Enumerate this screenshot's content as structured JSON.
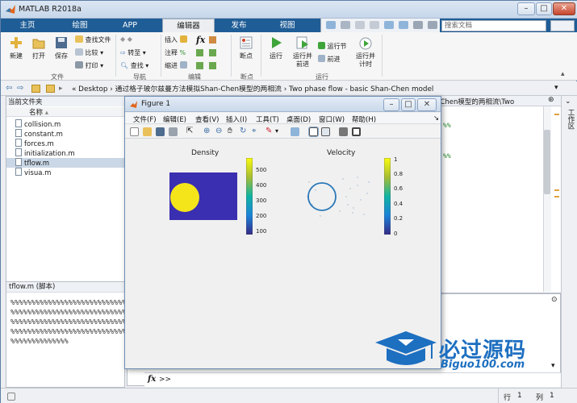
{
  "app": {
    "title": "MATLAB R2018a"
  },
  "tabs": [
    "主页",
    "绘图",
    "APP",
    "编辑器",
    "发布",
    "视图"
  ],
  "active_tab": "编辑器",
  "search": {
    "placeholder": "搜索文档"
  },
  "ribbon": {
    "file": {
      "new": "新建",
      "open": "打开",
      "save": "保存",
      "find_files": "查找文件",
      "compare": "比较",
      "print": "打印",
      "group": "文件"
    },
    "navigate": {
      "goto": "转至",
      "find": "查找",
      "group": "导航"
    },
    "edit": {
      "insert": "插入",
      "comment": "注释",
      "indent": "缩进",
      "fx": "fx",
      "group": "编辑"
    },
    "breakpoints": {
      "label": "断点",
      "group": "断点"
    },
    "run": {
      "run": "运行",
      "run_advance": "运行并\n前进",
      "run_section": "运行节",
      "advance": "前进",
      "run_time": "运行并\n计时",
      "group": "运行"
    }
  },
  "address": {
    "path": "« Desktop › 通过格子玻尔兹曼方法模拟Shan-Chen模型的两相流 › Two phase flow - basic Shan-Chen model",
    "editor_tab": "n-Chen模型的两相流\\Two"
  },
  "current_folder": {
    "header": "当前文件夹",
    "column": "名称",
    "files": [
      "collision.m",
      "constant.m",
      "forces.m",
      "initialization.m",
      "tflow.m",
      "visua.m"
    ],
    "selected": "tflow.m"
  },
  "details": {
    "header": "tflow.m  (脚本)",
    "lines": [
      "%%%%%%%%%%%%%%%%%%%%%%%%%%%%",
      "%%%%%%%%%%%%%%%%%%%%%%%%%%%%",
      "%%%%%%%%%%%%%%%%%%%%%%%%%%%%",
      "%%%%%%%%%%%%%%%%%%%%%%%%%%%%",
      "%%%%%%%%%%%%%%"
    ]
  },
  "editor_snippets": [
    "%%",
    "%%"
  ],
  "workspace_side": "工作区",
  "figure": {
    "title": "Figure 1",
    "menu": [
      "文件(F)",
      "编辑(E)",
      "查看(V)",
      "插入(I)",
      "工具(T)",
      "桌面(D)",
      "窗口(W)",
      "帮助(H)"
    ],
    "density": {
      "title": "Density",
      "ticks": [
        "500",
        "400",
        "300",
        "200",
        "100"
      ]
    },
    "velocity": {
      "title": "Velocity",
      "ticks": [
        "1",
        "0.8",
        "0.6",
        "0.4",
        "0.2",
        "0"
      ]
    }
  },
  "command": {
    "fx": "fx",
    "prompt": ">>"
  },
  "status": {
    "row_label": "行",
    "row": "1",
    "col_label": "列",
    "col": "1"
  },
  "watermark": {
    "title": "必过源码",
    "url": "Biguo100.com"
  },
  "colors": {
    "tabbar": "#1f5d96",
    "density_bg": "#3a2fb0",
    "droplet": "#f4e51b",
    "circle": "#2a78b8"
  }
}
